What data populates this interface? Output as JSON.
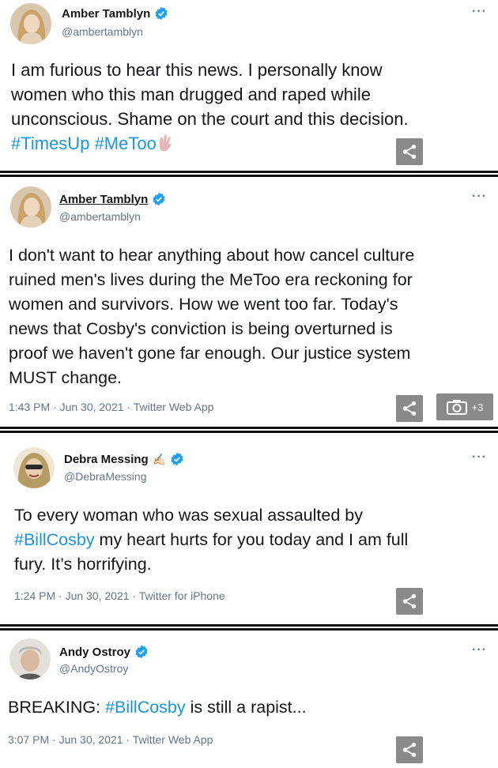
{
  "tweets": [
    {
      "name": "Amber Tamblyn",
      "handle": "@ambertamblyn",
      "more": "···",
      "lines": [
        "I am furious to hear this news. I personally know",
        "women who this man drugged and raped while",
        "unconscious. Shame on the court and this decision."
      ],
      "hashtags": [
        "#TimesUp",
        "#MeToo"
      ],
      "avatar": "woman-blonde-avatar"
    },
    {
      "name": "Amber Tamblyn",
      "handle": "@ambertamblyn",
      "more": "···",
      "lines": [
        "I don't want to hear anything about how cancel culture",
        "ruined men's lives during the MeToo era reckoning for",
        "women and survivors. How we went too far. Today's",
        "news that Cosby's conviction is being overturned is",
        "proof we haven't gone far enough. Our justice system",
        "MUST change."
      ],
      "meta": "1:43 PM · Jun 30, 2021 · Twitter Web App",
      "gallery_count": "+3",
      "avatar": "woman-blonde-avatar"
    },
    {
      "name": "Debra Messing",
      "handle": "@DebraMessing",
      "more": "···",
      "text_pre": "To every woman who was sexual assaulted by",
      "hashtag": "#BillCosby",
      "text_post": " my heart hurts for you today and I am full",
      "text_last": "fury. It’s horrifying.",
      "meta": "1:24 PM · Jun 30, 2021 · Twitter for iPhone",
      "name_emoji": "✍🏻",
      "avatar": "woman-sunglasses-avatar"
    },
    {
      "name": "Andy Ostroy",
      "handle": "@AndyOstroy",
      "more": "···",
      "text_pre": "BREAKING: ",
      "hashtag": "#BillCosby",
      "text_post": " is still a rapist...",
      "meta": "3:07 PM · Jun 30, 2021 · Twitter Web App",
      "avatar": "man-gray-hair-avatar"
    }
  ],
  "colors": {
    "link": "#1b95e0",
    "verified": "#1da1f2",
    "muted": "#657786",
    "share_bg": "#8a8a8a"
  }
}
